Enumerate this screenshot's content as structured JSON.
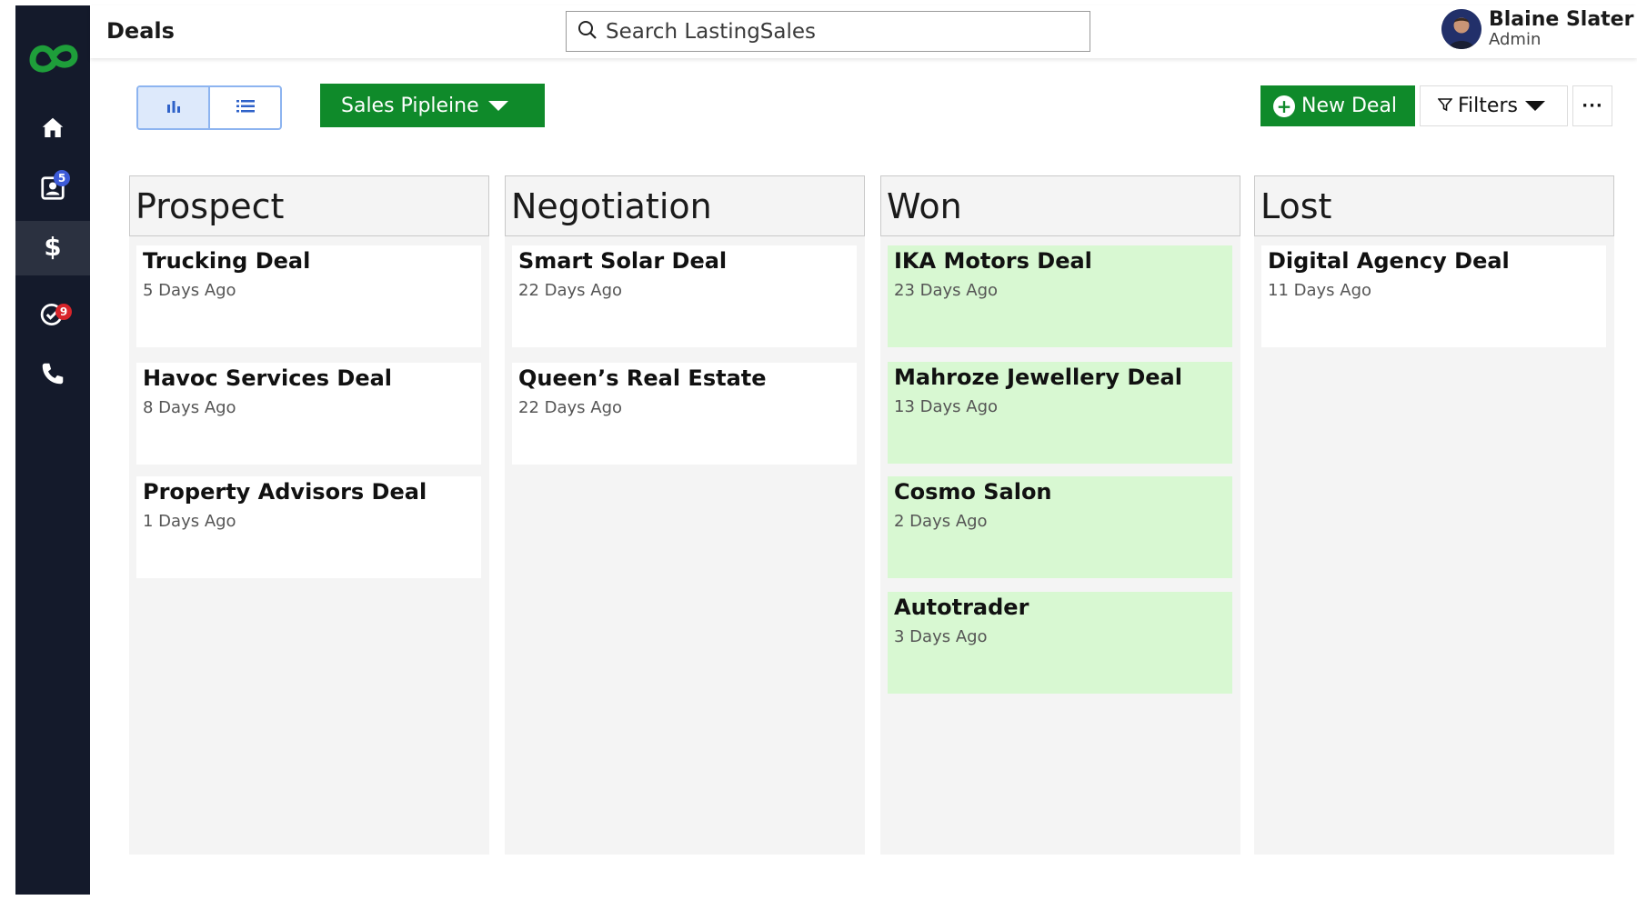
{
  "app": {
    "page_title": "Deals",
    "brand_color": "#0f8a2a",
    "sidebar_color": "#141a2b"
  },
  "search": {
    "placeholder": "Search LastingSales"
  },
  "user": {
    "name": "Blaine Slater",
    "role": "Admin"
  },
  "sidebar": {
    "items": [
      {
        "name": "home",
        "icon": "home-icon"
      },
      {
        "name": "contacts",
        "icon": "contacts-icon",
        "badge": "5"
      },
      {
        "name": "deals",
        "icon": "dollar-icon",
        "active": true
      },
      {
        "name": "tasks",
        "icon": "task-check-icon",
        "badge": "9"
      },
      {
        "name": "calls",
        "icon": "phone-icon"
      }
    ]
  },
  "toolbar": {
    "view_modes": [
      "kanban",
      "list"
    ],
    "pipeline_label": "Sales Pipleine",
    "new_deal_label": "New Deal",
    "filters_label": "Filters",
    "more_label": "···"
  },
  "columns": [
    {
      "title": "Prospect",
      "cards": [
        {
          "title": "Trucking Deal",
          "time": "5 Days Ago"
        },
        {
          "title": "Havoc Services Deal",
          "time": "8 Days Ago"
        },
        {
          "title": "Property Advisors Deal",
          "time": "1 Days Ago"
        }
      ]
    },
    {
      "title": "Negotiation",
      "cards": [
        {
          "title": "Smart Solar Deal",
          "time": "22 Days Ago"
        },
        {
          "title": "Queen’s Real Estate",
          "time": "22 Days Ago"
        }
      ]
    },
    {
      "title": "Won",
      "cards": [
        {
          "title": "IKA Motors Deal",
          "time": "23 Days Ago"
        },
        {
          "title": "Mahroze Jewellery Deal",
          "time": "13 Days Ago"
        },
        {
          "title": "Cosmo Salon",
          "time": "2 Days Ago"
        },
        {
          "title": "Autotrader",
          "time": "3 Days Ago"
        }
      ]
    },
    {
      "title": "Lost",
      "cards": [
        {
          "title": "Digital Agency Deal",
          "time": "11 Days Ago"
        }
      ]
    }
  ]
}
